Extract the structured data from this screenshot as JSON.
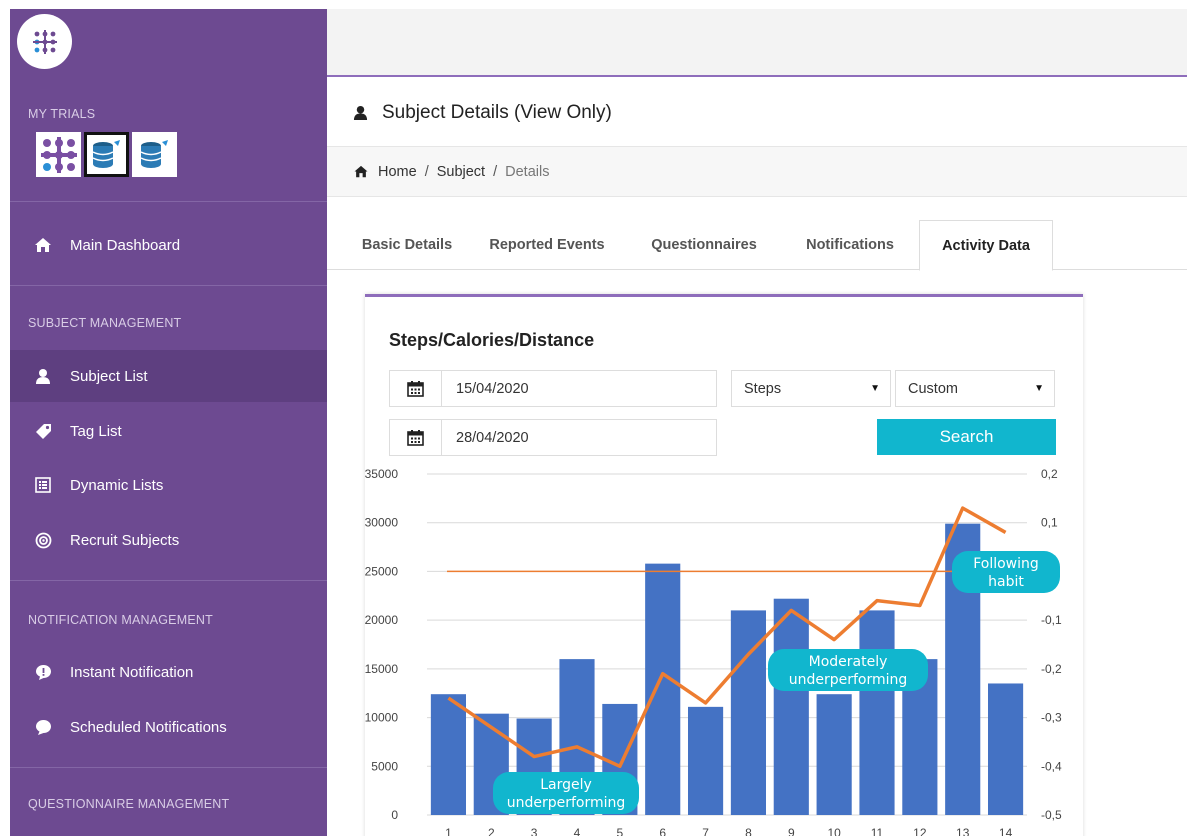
{
  "sidebar": {
    "trials_title": "MY TRIALS",
    "main_dashboard": "Main Dashboard",
    "subject_mgmt_title": "SUBJECT MANAGEMENT",
    "subject_list": "Subject List",
    "tag_list": "Tag List",
    "dynamic_lists": "Dynamic Lists",
    "recruit_subjects": "Recruit Subjects",
    "notification_mgmt_title": "NOTIFICATION MANAGEMENT",
    "instant_notification": "Instant Notification",
    "scheduled_notifications": "Scheduled Notifications",
    "questionnaire_mgmt_title": "QUESTIONNAIRE MANAGEMENT"
  },
  "header": {
    "title": "Subject Details (View Only)"
  },
  "breadcrumb": {
    "home": "Home",
    "sep1": "/",
    "subject": "Subject",
    "sep2": "/",
    "current": "Details"
  },
  "tabs": {
    "basic": "Basic Details",
    "reported": "Reported Events",
    "questionnaires": "Questionnaires",
    "notifications": "Notifications",
    "activity": "Activity Data"
  },
  "card": {
    "title": "Steps/Calories/Distance",
    "start_date": "15/04/2020",
    "end_date": "28/04/2020",
    "metric_select": "Steps",
    "range_select": "Custom",
    "search_label": "Search"
  },
  "colors": {
    "sidebar": "#6d4a91",
    "accent": "#8e6dbb",
    "button": "#11b6ce",
    "bar": "#4472c4",
    "line": "#ed7d31"
  },
  "chart_data": {
    "type": "bar",
    "categories": [
      "1",
      "2",
      "3",
      "4",
      "5",
      "6",
      "7",
      "8",
      "9",
      "10",
      "11",
      "12",
      "13",
      "14"
    ],
    "values": [
      12400,
      10400,
      9900,
      16000,
      11400,
      25800,
      11100,
      21000,
      22200,
      12400,
      21000,
      16000,
      29900,
      13500
    ],
    "ylim": [
      0,
      35000
    ],
    "yticks": [
      "35000",
      "30000",
      "25000",
      "20000",
      "15000",
      "10000",
      "5000",
      "0"
    ],
    "y2ticks": [
      "0,2",
      "0,1",
      "0",
      "-0,1",
      "-0,2",
      "-0,3",
      "-0,4",
      "-0,5"
    ],
    "y2lim": [
      -0.5,
      0.2
    ],
    "reference_value": 25000,
    "line_series": {
      "values": [
        -0.26,
        -0.32,
        -0.38,
        -0.36,
        -0.4,
        -0.21,
        -0.27,
        -0.17,
        -0.08,
        -0.14,
        -0.06,
        -0.07,
        0.13,
        0.08
      ]
    },
    "annotations": {
      "largely": [
        "Largely",
        "underperforming"
      ],
      "moderately": [
        "Moderately",
        "underperforming"
      ],
      "following": [
        "Following",
        "habit"
      ]
    },
    "grid": true
  }
}
